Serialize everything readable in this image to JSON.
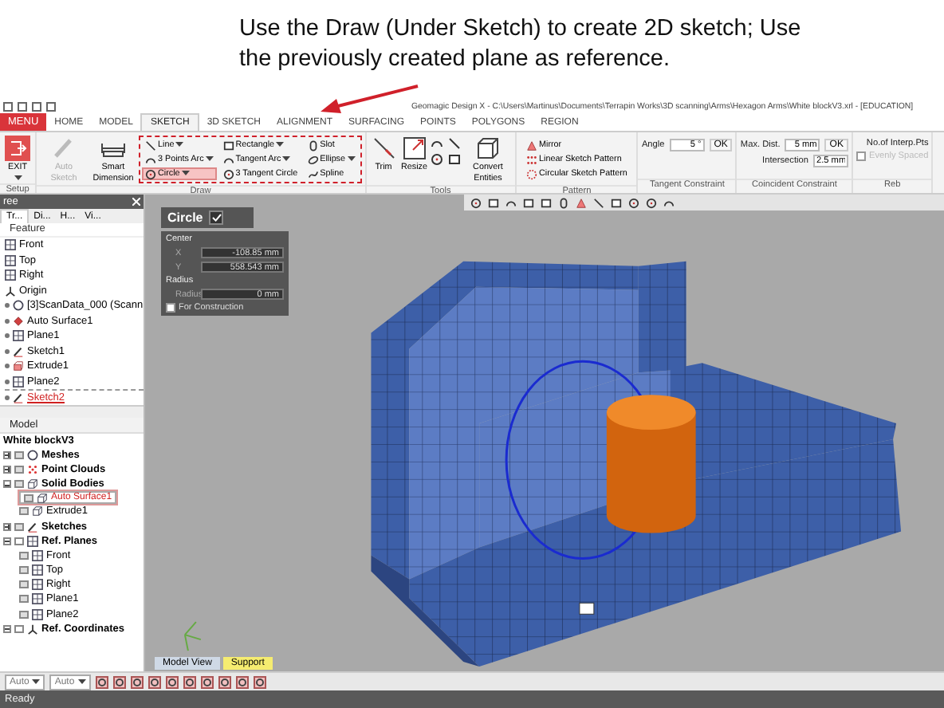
{
  "caption": {
    "lines": [
      "Use the Draw (Under Sketch) to create 2D sketch; Use",
      "the previously created plane as reference."
    ]
  },
  "window": {
    "title": "Geomagic Design X - C:\\Users\\Martinus\\Documents\\Terrapin Works\\3D scanning\\Arms\\Hexagon Arms\\White blockV3.xrl - [EDUCATION]"
  },
  "app_menu": "MENU",
  "tabs": [
    {
      "label": "HOME",
      "selected": false
    },
    {
      "label": "MODEL",
      "selected": false
    },
    {
      "label": "SKETCH",
      "selected": true
    },
    {
      "label": "3D SKETCH",
      "selected": false
    },
    {
      "label": "ALIGNMENT",
      "selected": false
    },
    {
      "label": "SURFACING",
      "selected": false
    },
    {
      "label": "POINTS",
      "selected": false
    },
    {
      "label": "POLYGONS",
      "selected": false
    },
    {
      "label": "REGION",
      "selected": false
    }
  ],
  "ribbon": [
    {
      "label": "Setup",
      "highlighted": false,
      "large": [
        {
          "label": "EXIT",
          "disabled": false,
          "dropdown": true
        }
      ]
    },
    {
      "label": "Draw",
      "highlighted": true,
      "large": [
        {
          "label": "Auto Sketch",
          "disabled": true,
          "dropdown": false
        },
        {
          "label": "Smart Dimension",
          "disabled": false,
          "dropdown": false
        }
      ],
      "columns": [
        [
          {
            "label": "Line",
            "dropdown": true,
            "selected": false
          },
          {
            "label": "3 Points Arc",
            "dropdown": true,
            "selected": false
          },
          {
            "label": "Circle",
            "dropdown": true,
            "selected": true
          }
        ],
        [
          {
            "label": "Rectangle",
            "dropdown": true,
            "selected": false
          },
          {
            "label": "Tangent Arc",
            "dropdown": true,
            "selected": false
          },
          {
            "label": "3 Tangent Circle",
            "dropdown": false,
            "selected": false
          }
        ],
        [
          {
            "label": "Slot",
            "dropdown": false,
            "selected": false
          },
          {
            "label": "Ellipse",
            "dropdown": true,
            "selected": false
          },
          {
            "label": "Spline",
            "dropdown": false,
            "selected": false
          }
        ]
      ]
    },
    {
      "label": "Tools",
      "highlighted": false,
      "large": [
        {
          "label": "Trim",
          "disabled": false,
          "dropdown": false
        },
        {
          "label": "Resize",
          "disabled": false,
          "dropdown": false
        },
        {
          "label": "Convert Entities",
          "disabled": false,
          "dropdown": false
        }
      ]
    },
    {
      "label": "Pattern",
      "highlighted": false,
      "columns": [
        [
          {
            "label": "Mirror",
            "dropdown": false,
            "selected": false
          },
          {
            "label": "Linear Sketch Pattern",
            "dropdown": false,
            "selected": false
          },
          {
            "label": "Circular Sketch Pattern",
            "dropdown": false,
            "selected": false
          }
        ]
      ]
    },
    {
      "label": "Tangent Constraint",
      "highlighted": false,
      "fields": [
        {
          "kind": "field",
          "label": "Angle",
          "value": "5 °",
          "button": "OK"
        }
      ]
    },
    {
      "label": "Coincident Constraint",
      "highlighted": false,
      "fields": [
        {
          "kind": "field",
          "label": "Max. Dist.",
          "value": "5 mm",
          "button": "OK"
        },
        {
          "kind": "field",
          "label": "Intersection",
          "value": "2.5 mm"
        }
      ]
    },
    {
      "label": "Reb",
      "highlighted": false,
      "fields": [
        {
          "kind": "text",
          "label": "No.of Interp.Pts"
        },
        {
          "kind": "checkbox",
          "label": "Evenly Spaced",
          "checked": false,
          "disabled": true
        }
      ]
    }
  ],
  "feature_tree": {
    "title": "ree",
    "tabs": [
      {
        "label": "Tr...",
        "selected": true
      },
      {
        "label": "Di...",
        "selected": false
      },
      {
        "label": "H...",
        "selected": false
      },
      {
        "label": "Vi...",
        "selected": false
      }
    ],
    "heading": "Feature",
    "items": [
      {
        "label": "Front",
        "kind": "plane",
        "editing": false
      },
      {
        "label": "Top",
        "kind": "plane",
        "editing": false
      },
      {
        "label": "Right",
        "kind": "plane",
        "editing": false
      },
      {
        "label": "Origin",
        "kind": "origin",
        "editing": false
      },
      {
        "label": "[3]ScanData_000 (Scann",
        "kind": "scan",
        "editing": false
      },
      {
        "label": "Auto Surface1",
        "kind": "surface",
        "editing": false
      },
      {
        "label": "Plane1",
        "kind": "plane",
        "editing": false
      },
      {
        "label": "Sketch1",
        "kind": "sketch",
        "editing": false
      },
      {
        "label": "Extrude1",
        "kind": "extrude",
        "editing": false
      },
      {
        "label": "Plane2",
        "kind": "plane",
        "editing": false
      },
      {
        "label": "Sketch2",
        "kind": "sketch",
        "editing": true
      }
    ]
  },
  "model_tree": {
    "heading": "Model",
    "root": "White blockV3",
    "nodes": [
      {
        "label": "Meshes",
        "kind": "scan",
        "expanded": false,
        "visible": true
      },
      {
        "label": "Point Clouds",
        "kind": "points",
        "expanded": false,
        "visible": true
      },
      {
        "label": "Solid Bodies",
        "kind": "solid",
        "expanded": true,
        "visible": true,
        "children": [
          {
            "label": "Auto Surface1",
            "kind": "solid",
            "selected": true,
            "visible": true
          },
          {
            "label": "Extrude1",
            "kind": "solid",
            "selected": false,
            "visible": true
          }
        ]
      },
      {
        "label": "Sketches",
        "kind": "sketch",
        "expanded": false,
        "visible": true
      },
      {
        "label": "Ref. Planes",
        "kind": "plane",
        "expanded": true,
        "visible": false,
        "children": [
          {
            "label": "Front",
            "kind": "plane",
            "selected": false,
            "visible": true
          },
          {
            "label": "Top",
            "kind": "plane",
            "selected": false,
            "visible": true
          },
          {
            "label": "Right",
            "kind": "plane",
            "selected": false,
            "visible": true
          },
          {
            "label": "Plane1",
            "kind": "plane",
            "selected": false,
            "visible": true
          },
          {
            "label": "Plane2",
            "kind": "plane",
            "selected": false,
            "visible": true
          }
        ]
      },
      {
        "label": "Ref. Coordinates",
        "kind": "origin",
        "expanded": true,
        "visible": false
      }
    ]
  },
  "circle_panel": {
    "title": "Circle",
    "sections": [
      {
        "label": "Center",
        "rows": [
          {
            "label": "X",
            "value": "-108.85 mm"
          },
          {
            "label": "Y",
            "value": "558.543 mm"
          }
        ]
      },
      {
        "label": "Radius",
        "rows": [
          {
            "label": "Radius",
            "value": "0 mm"
          }
        ]
      }
    ],
    "construction": {
      "label": "For Construction",
      "checked": false
    }
  },
  "view_tabs": [
    {
      "label": "Model View",
      "selected": false
    },
    {
      "label": "Support",
      "selected": true
    }
  ],
  "bottom_toolbar": {
    "selects": [
      "Auto",
      "Auto"
    ]
  },
  "status_bar": "Ready"
}
